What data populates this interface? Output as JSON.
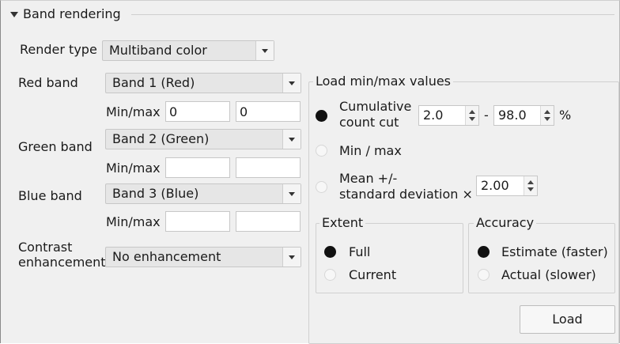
{
  "section": {
    "title": "Band rendering"
  },
  "render_type": {
    "label": "Render type",
    "value": "Multiband color"
  },
  "bands": [
    {
      "label": "Red band",
      "value": "Band 1 (Red)",
      "minmax_label": "Min/max",
      "min": "0",
      "max": "0"
    },
    {
      "label": "Green band",
      "value": "Band 2 (Green)",
      "minmax_label": "Min/max",
      "min": "",
      "max": ""
    },
    {
      "label": "Blue band",
      "value": "Band 3 (Blue)",
      "minmax_label": "Min/max",
      "min": "",
      "max": ""
    }
  ],
  "contrast": {
    "label_line1": "Contrast",
    "label_line2": "enhancement",
    "value": "No enhancement"
  },
  "load_group": {
    "title": "Load min/max values",
    "cumulative": {
      "label_line1": "Cumulative",
      "label_line2": "count cut",
      "low": "2.0",
      "dash": "-",
      "high": "98.0",
      "unit": "%",
      "selected": true
    },
    "minmax": {
      "label": "Min / max",
      "selected": false
    },
    "meanstd": {
      "label_line1": "Mean +/-",
      "label_line2": "standard deviation ×",
      "value": "2.00",
      "selected": false
    },
    "extent": {
      "title": "Extent",
      "options": [
        "Full",
        "Current"
      ],
      "selected": "Full"
    },
    "accuracy": {
      "title": "Accuracy",
      "options": [
        "Estimate (faster)",
        "Actual (slower)"
      ],
      "selected": "Estimate (faster)"
    },
    "load_button": "Load"
  }
}
